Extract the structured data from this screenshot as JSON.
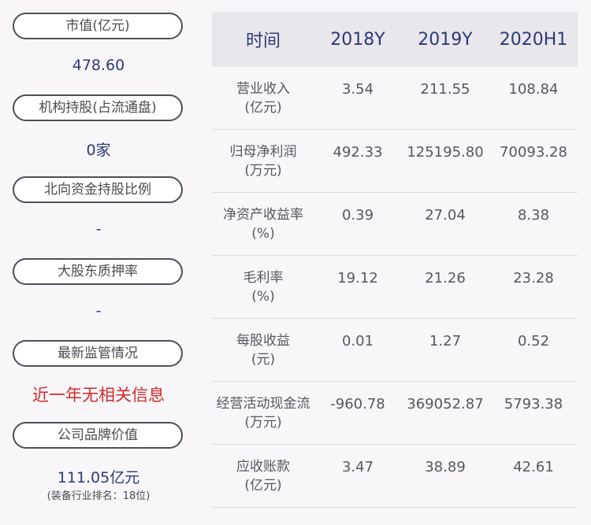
{
  "left": {
    "market_value": {
      "label": "市值(亿元)",
      "value": "478.60"
    },
    "institution_holding": {
      "label": "机构持股(占流通盘)",
      "value": "0家"
    },
    "northbound_ratio": {
      "label": "北向资金持股比例",
      "value": "-"
    },
    "pledge_ratio": {
      "label": "大股东质押率",
      "value": "-"
    },
    "regulatory": {
      "label": "最新监管情况",
      "value": "近一年无相关信息"
    },
    "brand_value": {
      "label": "公司品牌价值",
      "value": "111.05亿元",
      "note": "(装备行业排名：18位)"
    }
  },
  "table": {
    "headers": [
      "时间",
      "2018Y",
      "2019Y",
      "2020H1"
    ],
    "rows": [
      {
        "name": "营业收入",
        "unit": "(亿元)",
        "values": [
          "3.54",
          "211.55",
          "108.84"
        ]
      },
      {
        "name": "归母净利润",
        "unit": "(万元)",
        "values": [
          "492.33",
          "125195.80",
          "70093.28"
        ]
      },
      {
        "name": "净资产收益率",
        "unit": "(%)",
        "values": [
          "0.39",
          "27.04",
          "8.38"
        ]
      },
      {
        "name": "毛利率",
        "unit": "(%)",
        "values": [
          "19.12",
          "21.26",
          "23.28"
        ]
      },
      {
        "name": "每股收益",
        "unit": "(元)",
        "values": [
          "0.01",
          "1.27",
          "0.52"
        ]
      },
      {
        "name": "经营活动现金流",
        "unit": "(万元)",
        "values": [
          "-960.78",
          "369052.87",
          "5793.38"
        ]
      },
      {
        "name": "应收账款",
        "unit": "(亿元)",
        "values": [
          "3.47",
          "38.89",
          "42.61"
        ]
      }
    ]
  },
  "colors": {
    "accent_blue": "#2c3a78",
    "alert_red": "#d42a2a",
    "header_bg": "#e9e6ec"
  }
}
